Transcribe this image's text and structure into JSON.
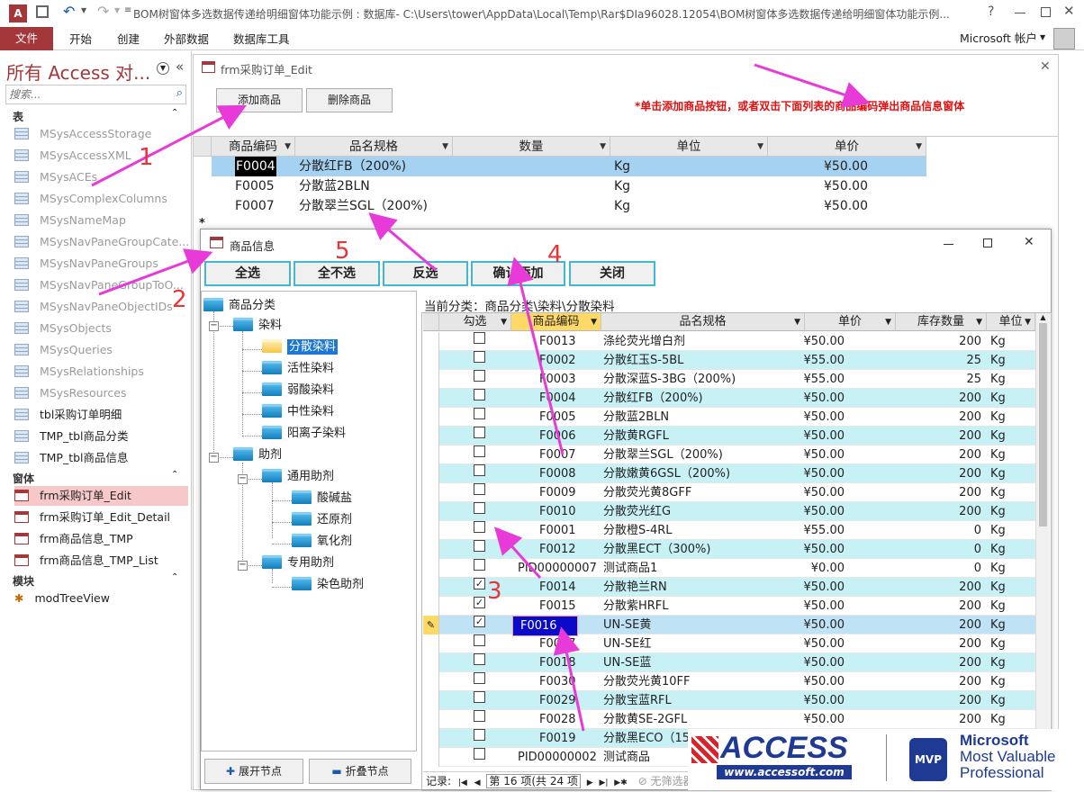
{
  "window": {
    "title": "BOM树窗体多选数据传递给明细窗体功能示例 : 数据库- C:\\Users\\tower\\AppData\\Local\\Temp\\Rar$DIa96028.12054\\BOM树窗体多选数据传递给明细窗体功能示例..."
  },
  "ribbon": {
    "tabs": [
      "文件",
      "开始",
      "创建",
      "外部数据",
      "数据库工具"
    ],
    "account": "Microsoft 帐户"
  },
  "nav": {
    "title": "所有 Access 对...",
    "search_placeholder": "搜索...",
    "sections": {
      "tables": "表",
      "forms": "窗体",
      "modules": "模块"
    },
    "tables": [
      "MSysAccessStorage",
      "MSysAccessXML",
      "MSysACEs",
      "MSysComplexColumns",
      "MSysNameMap",
      "MSysNavPaneGroupCate...",
      "MSysNavPaneGroups",
      "MSysNavPaneGroupToO...",
      "MSysNavPaneObjectIDs",
      "MSysObjects",
      "MSysQueries",
      "MSysRelationships",
      "MSysResources",
      "tbl采购订单明细",
      "TMP_tbl商品分类",
      "TMP_tbl商品信息"
    ],
    "forms": [
      "frm采购订单_Edit",
      "frm采购订单_Edit_Detail",
      "frm商品信息_TMP",
      "frm商品信息_TMP_List"
    ],
    "modules": [
      "modTreeView"
    ]
  },
  "form1": {
    "title": "frm采购订单_Edit",
    "add_button": "添加商品",
    "delete_button": "删除商品",
    "hint": "*单击添加商品按钮，或者双击下面列表的商品编码弹出商品信息窗体",
    "columns": [
      "商品编码",
      "品名规格",
      "数量",
      "单位",
      "单价"
    ],
    "rows": [
      {
        "code": "F0004",
        "name": "分散红FB（200%)",
        "qty": "",
        "unit": "Kg",
        "price": "¥50.00"
      },
      {
        "code": "F0005",
        "name": "分散蓝2BLN",
        "qty": "",
        "unit": "Kg",
        "price": "¥50.00"
      },
      {
        "code": "F0007",
        "name": "分散翠兰SGL（200%)",
        "qty": "",
        "unit": "Kg",
        "price": "¥50.00"
      }
    ],
    "new_row_marker": "*"
  },
  "form2": {
    "title": "商品信息",
    "buttons": [
      "全选",
      "全不选",
      "反选",
      "确认添加",
      "关闭"
    ],
    "tree": {
      "root": "商品分类",
      "nodes": [
        "染料",
        "分散染料",
        "活性染料",
        "弱酸染料",
        "中性染料",
        "阳离子染料",
        "助剂",
        "通用助剂",
        "酸碱盐",
        "还原剂",
        "氧化剂",
        "专用助剂",
        "染色助剂"
      ]
    },
    "expand_button": "展开节点",
    "collapse_button": "折叠节点",
    "current_category": "当前分类：商品分类\\染料\\分散染料",
    "columns": [
      "勾选",
      "商品编码",
      "品名规格",
      "单价",
      "库存数量",
      "单位"
    ],
    "rows": [
      {
        "checked": false,
        "code": "F0013",
        "name": "涤纶荧光增白剂",
        "price": "¥50.00",
        "stock": "200",
        "unit": "Kg"
      },
      {
        "checked": false,
        "code": "F0002",
        "name": "分散红玉S-5BL",
        "price": "¥55.00",
        "stock": "25",
        "unit": "Kg"
      },
      {
        "checked": false,
        "code": "F0003",
        "name": "分散深蓝S-3BG（200%)",
        "price": "¥55.00",
        "stock": "25",
        "unit": "Kg"
      },
      {
        "checked": false,
        "code": "F0004",
        "name": "分散红FB（200%)",
        "price": "¥50.00",
        "stock": "200",
        "unit": "Kg"
      },
      {
        "checked": false,
        "code": "F0005",
        "name": "分散蓝2BLN",
        "price": "¥50.00",
        "stock": "200",
        "unit": "Kg"
      },
      {
        "checked": false,
        "code": "F0006",
        "name": "分散黄RGFL",
        "price": "¥50.00",
        "stock": "200",
        "unit": "Kg"
      },
      {
        "checked": false,
        "code": "F0007",
        "name": "分散翠兰SGL（200%)",
        "price": "¥50.00",
        "stock": "200",
        "unit": "Kg"
      },
      {
        "checked": false,
        "code": "F0008",
        "name": "分散嫩黄6GSL（200%)",
        "price": "¥50.00",
        "stock": "200",
        "unit": "Kg"
      },
      {
        "checked": false,
        "code": "F0009",
        "name": "分散荧光黄8GFF",
        "price": "¥50.00",
        "stock": "200",
        "unit": "Kg"
      },
      {
        "checked": false,
        "code": "F0010",
        "name": "分散荧光红G",
        "price": "¥50.00",
        "stock": "200",
        "unit": "Kg"
      },
      {
        "checked": false,
        "code": "F0001",
        "name": "分散橙S-4RL",
        "price": "¥55.00",
        "stock": "0",
        "unit": "Kg"
      },
      {
        "checked": false,
        "code": "F0012",
        "name": "分散黑ECT（300%)",
        "price": "¥50.00",
        "stock": "0",
        "unit": "Kg"
      },
      {
        "checked": false,
        "code": "PID00000007",
        "name": "测试商品1",
        "price": "¥0.00",
        "stock": "0",
        "unit": "Kg"
      },
      {
        "checked": true,
        "code": "F0014",
        "name": "分散艳兰RN",
        "price": "¥50.00",
        "stock": "200",
        "unit": "Kg"
      },
      {
        "checked": true,
        "code": "F0015",
        "name": "分散紫HRFL",
        "price": "¥50.00",
        "stock": "200",
        "unit": "Kg"
      },
      {
        "checked": true,
        "code": "F0016",
        "name": "UN-SE黄",
        "price": "¥50.00",
        "stock": "200",
        "unit": "Kg"
      },
      {
        "checked": false,
        "code": "F0017",
        "name": "UN-SE红",
        "price": "¥50.00",
        "stock": "200",
        "unit": "Kg"
      },
      {
        "checked": false,
        "code": "F0018",
        "name": "UN-SE蓝",
        "price": "¥50.00",
        "stock": "200",
        "unit": "Kg"
      },
      {
        "checked": false,
        "code": "F0030",
        "name": "分散荧光黄10FF",
        "price": "¥50.00",
        "stock": "200",
        "unit": "Kg"
      },
      {
        "checked": false,
        "code": "F0029",
        "name": "分散宝蓝RFL",
        "price": "¥50.00",
        "stock": "200",
        "unit": "Kg"
      },
      {
        "checked": false,
        "code": "F0028",
        "name": "分散黄SE-2GFL",
        "price": "¥50.00",
        "stock": "200",
        "unit": "Kg"
      },
      {
        "checked": false,
        "code": "F0019",
        "name": "分散黑ECO（15",
        "price": "¥50.00",
        "stock": "200",
        "unit": "Kg"
      },
      {
        "checked": false,
        "code": "PID00000002",
        "name": "测试商品",
        "price": "",
        "stock": "",
        "unit": ""
      }
    ],
    "record_nav": {
      "label": "记录:",
      "position": "第 16 项(共 24 项",
      "filter": "无筛选器"
    }
  },
  "annotations": [
    "1",
    "2",
    "3",
    "4",
    "5"
  ],
  "logo": {
    "brand": "ACCESS",
    "url": "www.accessoft.com",
    "badge": "MVP",
    "line1": "Microsoft",
    "line2": "Most Valuable",
    "line3": "Professional"
  },
  "colors": {
    "access_red": "#a4373a",
    "arrow": "#e83ad8",
    "annotation": "#e8333a",
    "row_alt": "#c8f1f6",
    "header_gold": "#ffd966"
  }
}
